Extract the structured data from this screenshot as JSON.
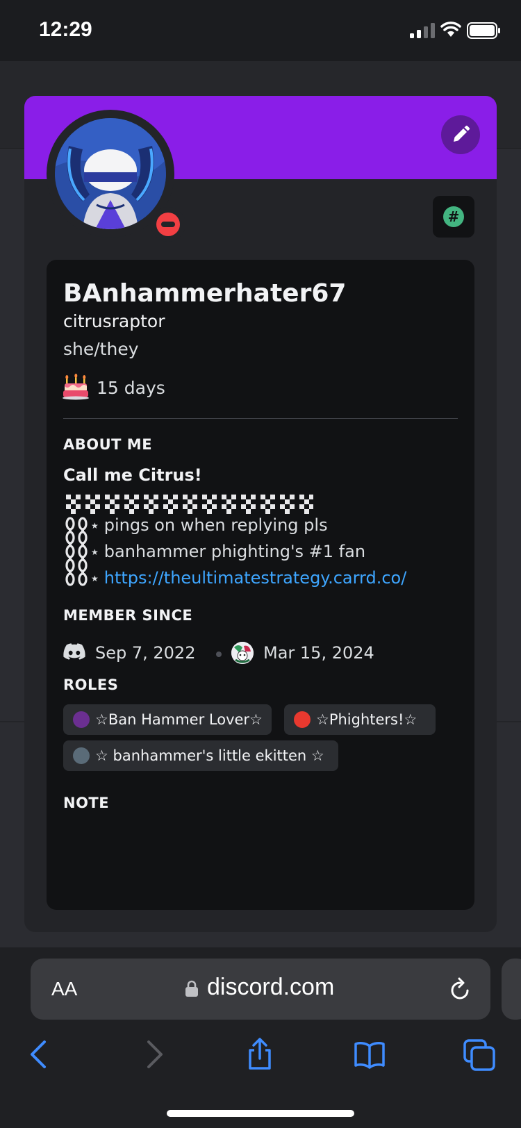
{
  "status_bar": {
    "time": "12:29"
  },
  "profile": {
    "display_name": "BAnhammerhater67",
    "username": "citrusraptor",
    "pronouns": "she/they",
    "member_duration": "15 days",
    "banner_color": "#8a1ee8",
    "status": "do-not-disturb",
    "badge_icon": "hashtag-badge-icon",
    "badge_symbol": "#"
  },
  "about_me": {
    "title": "ABOUT ME",
    "heading": "Call me Citrus!",
    "lines": [
      "pings on when replying pls",
      "banhammer phighting's #1 fan"
    ],
    "link": "https://theultimatestrategy.carrd.co/"
  },
  "member_since": {
    "title": "MEMBER SINCE",
    "discord_date": "Sep 7, 2022",
    "server_date": "Mar 15, 2024"
  },
  "roles": {
    "title": "ROLES",
    "items": [
      {
        "label": "☆Ban Hammer Lover☆",
        "color": "#6b2f91"
      },
      {
        "label": "☆Phighters!☆",
        "color": "#e8392f"
      },
      {
        "label": "☆ banhammer's little ekitten ☆",
        "color": "#5a6b78"
      }
    ]
  },
  "note": {
    "title": "NOTE"
  },
  "browser": {
    "text_size_label": "AA",
    "url": "discord.com"
  }
}
